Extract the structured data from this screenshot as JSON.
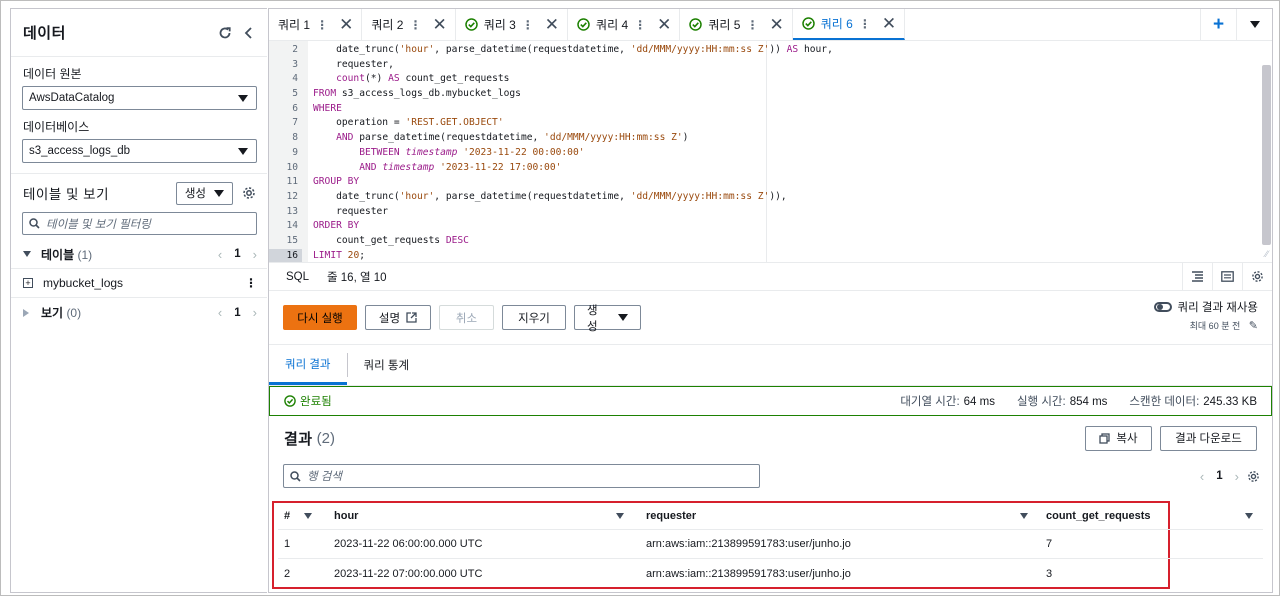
{
  "left_panel": {
    "title": "데이터",
    "source_label": "데이터 원본",
    "source_value": "AwsDataCatalog",
    "db_label": "데이터베이스",
    "db_value": "s3_access_logs_db",
    "tables_views_title": "테이블 및 보기",
    "create_label": "생성",
    "filter_placeholder": "테이블 및 보기 필터링",
    "tables_group": {
      "label": "테이블",
      "count": "(1)",
      "page": "1"
    },
    "table_items": [
      "mybucket_logs"
    ],
    "views_group": {
      "label": "보기",
      "count": "(0)",
      "page": "1"
    }
  },
  "tabs": [
    {
      "label": "쿼리 1",
      "status": "none"
    },
    {
      "label": "쿼리 2",
      "status": "none"
    },
    {
      "label": "쿼리 3",
      "status": "ok"
    },
    {
      "label": "쿼리 4",
      "status": "ok"
    },
    {
      "label": "쿼리 5",
      "status": "ok"
    },
    {
      "label": "쿼리 6",
      "status": "ok",
      "active": true
    }
  ],
  "editor": {
    "lines": [
      {
        "n": "2",
        "html": "    date_trunc(<span class='str'>'hour'</span>, parse_datetime(requestdatetime, <span class='str'>'dd/MMM/yyyy:HH:mm:ss Z'</span>)) <span class='kw'>AS</span> hour,"
      },
      {
        "n": "3",
        "html": "    requester,"
      },
      {
        "n": "4",
        "html": "    <span class='kw'>count</span>(*) <span class='kw'>AS</span> count_get_requests"
      },
      {
        "n": "5",
        "html": "<span class='kw'>FROM</span> s3_access_logs_db.mybucket_logs"
      },
      {
        "n": "6",
        "html": "<span class='kw'>WHERE</span>"
      },
      {
        "n": "7",
        "html": "    operation = <span class='str'>'REST.GET.OBJECT'</span>"
      },
      {
        "n": "8",
        "html": "    <span class='kw'>AND</span> parse_datetime(requestdatetime, <span class='str'>'dd/MMM/yyyy:HH:mm:ss Z'</span>)"
      },
      {
        "n": "9",
        "html": "        <span class='kw'>BETWEEN</span> <span class='it'>timestamp</span> <span class='str'>'2023-11-22 00:00:00'</span>"
      },
      {
        "n": "10",
        "html": "        <span class='kw'>AND</span> <span class='it'>timestamp</span> <span class='str'>'2023-11-22 17:00:00'</span>"
      },
      {
        "n": "11",
        "html": "<span class='kw'>GROUP BY</span>"
      },
      {
        "n": "12",
        "html": "    date_trunc(<span class='str'>'hour'</span>, parse_datetime(requestdatetime, <span class='str'>'dd/MMM/yyyy:HH:mm:ss Z'</span>)),"
      },
      {
        "n": "13",
        "html": "    requester"
      },
      {
        "n": "14",
        "html": "<span class='kw'>ORDER BY</span>"
      },
      {
        "n": "15",
        "html": "    count_get_requests <span class='kw'>DESC</span>"
      },
      {
        "n": "16",
        "html": "<span class='kw'>LIMIT</span> <span class='str'>20</span>;",
        "current": true
      }
    ]
  },
  "status_bar": {
    "language": "SQL",
    "position": "줄 16, 열 10"
  },
  "actions": {
    "run_again": "다시 실행",
    "explain": "설명",
    "cancel": "취소",
    "clear": "지우기",
    "create": "생성",
    "reuse_label": "쿼리 결과 재사용",
    "reuse_sub": "최대 60 분 전"
  },
  "result_tabs": [
    "쿼리 결과",
    "쿼리 통계"
  ],
  "completion": {
    "status": "완료됨",
    "queue_label": "대기열 시간:",
    "queue_value": "64 ms",
    "run_label": "실행 시간:",
    "run_value": "854 ms",
    "scan_label": "스캔한 데이터:",
    "scan_value": "245.33 KB"
  },
  "results": {
    "title": "결과",
    "count": "(2)",
    "copy_label": "복사",
    "download_label": "결과 다운로드",
    "search_placeholder": "행 검색",
    "page": "1",
    "columns": [
      "#",
      "hour",
      "requester",
      "count_get_requests"
    ],
    "rows": [
      [
        "1",
        "2023-11-22 06:00:00.000 UTC",
        "arn:aws:iam::213899591783:user/junho.jo",
        "7"
      ],
      [
        "2",
        "2023-11-22 07:00:00.000 UTC",
        "arn:aws:iam::213899591783:user/junho.jo",
        "3"
      ]
    ]
  },
  "colors": {
    "accent": "#0972d3",
    "primary_button": "#ec7211",
    "success": "#1d8102",
    "highlight_border": "#d6202d"
  }
}
